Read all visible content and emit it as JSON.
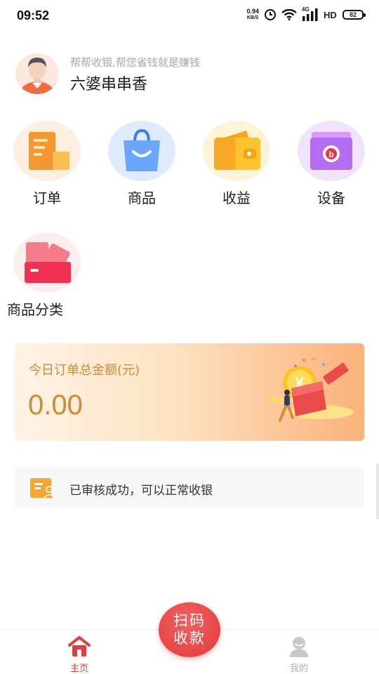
{
  "status_bar": {
    "time": "09:52",
    "net_speed_value": "0.94",
    "net_speed_unit": "KB/S",
    "network": "4G",
    "hd": "HD",
    "battery": "82",
    "icons": [
      "alarm-icon",
      "wifi-icon",
      "signal-icon",
      "hd-icon",
      "battery-icon"
    ]
  },
  "profile": {
    "slogan": "帮帮收银,帮您省钱就是赚钱",
    "name": "六婆串串香"
  },
  "menu": [
    {
      "label": "订单",
      "icon": "order-icon",
      "color": "#f7a042"
    },
    {
      "label": "商品",
      "icon": "bag-icon",
      "color": "#5d9cf8"
    },
    {
      "label": "收益",
      "icon": "wallet-icon",
      "color": "#fbc02d"
    },
    {
      "label": "设备",
      "icon": "device-box-icon",
      "color": "#b36df5"
    },
    {
      "label": "商品分类",
      "icon": "category-cards-icon",
      "color": "#f24d6a"
    }
  ],
  "orders": {
    "title": "今日订单总金额(元)",
    "amount": "0.00"
  },
  "notice": {
    "text": "已审核成功，可以正常收银"
  },
  "scan_button": {
    "line1": "扫码",
    "line2": "收款"
  },
  "tabs": {
    "home": "主页",
    "mine": "我的"
  },
  "colors": {
    "accent": "#e33d3d",
    "amount": "#cf8a33",
    "title": "#d7892e"
  }
}
